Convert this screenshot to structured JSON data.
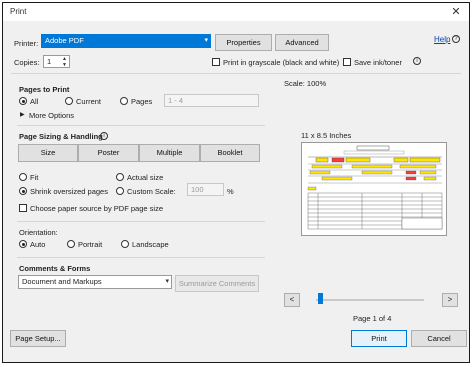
{
  "window": {
    "title": "Print"
  },
  "printer": {
    "label": "Printer:",
    "selected": "Adobe PDF",
    "properties_label": "Properties",
    "advanced_label": "Advanced",
    "help_label": "Help"
  },
  "copies": {
    "label": "Copies:",
    "value": "1",
    "grayscale_label": "Print in grayscale (black and white)",
    "save_ink_label": "Save ink/toner"
  },
  "pages_to_print": {
    "heading": "Pages to Print",
    "all_label": "All",
    "current_label": "Current",
    "pages_label": "Pages",
    "pages_value": "1 - 4",
    "more_options_label": "More Options"
  },
  "sizing": {
    "heading": "Page Sizing & Handling",
    "tabs": [
      "Size",
      "Poster",
      "Multiple",
      "Booklet"
    ],
    "fit_label": "Fit",
    "actual_size_label": "Actual size",
    "shrink_label": "Shrink oversized pages",
    "custom_scale_label": "Custom Scale:",
    "custom_scale_value": "100",
    "percent_label": "%",
    "choose_source_label": "Choose paper source by PDF page size"
  },
  "orientation": {
    "heading": "Orientation:",
    "auto_label": "Auto",
    "portrait_label": "Portrait",
    "landscape_label": "Landscape"
  },
  "comments_forms": {
    "heading": "Comments & Forms",
    "selected": "Document and Markups",
    "summarize_label": "Summarize Comments"
  },
  "preview": {
    "scale_label": "Scale: 100%",
    "paper_size_label": "11 x 8.5 Inches",
    "page_indicator": "Page 1 of 4",
    "prev_label": "<",
    "next_label": ">"
  },
  "footer": {
    "page_setup_label": "Page Setup...",
    "print_label": "Print",
    "cancel_label": "Cancel"
  },
  "colors": {
    "accent": "#0078d7",
    "selection": "#0078d7",
    "link": "#0645ad",
    "preview_highlight": "#ffe600"
  }
}
